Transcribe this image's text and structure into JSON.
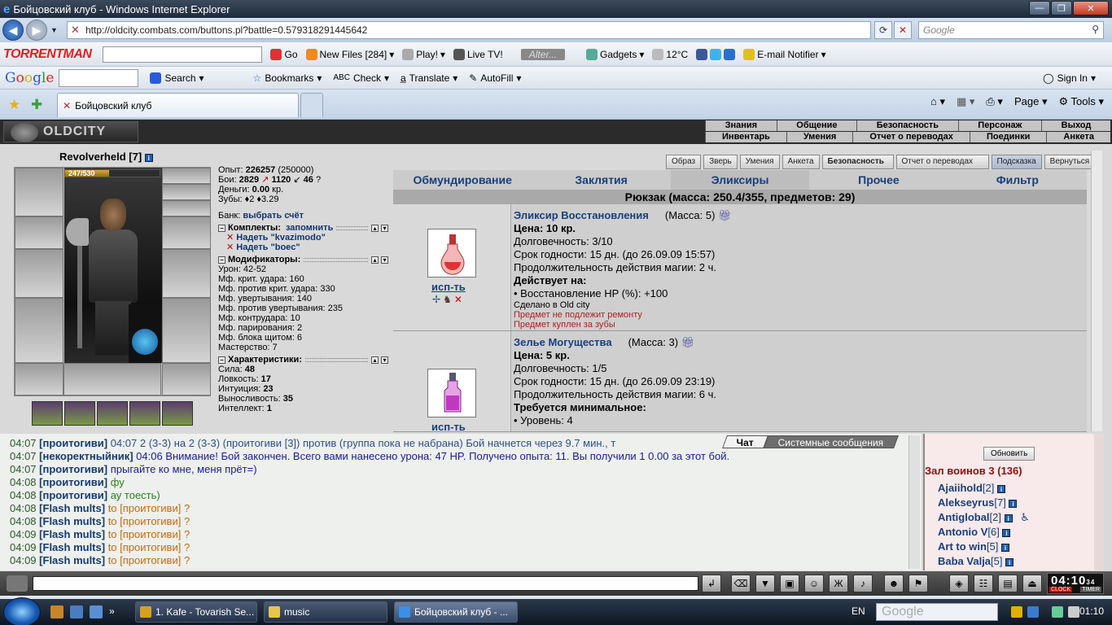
{
  "window": {
    "title": "Бойцовский клуб - Windows Internet Explorer",
    "url": "http://oldcity.combats.com/buttons.pl?battle=0.579318291445642",
    "search_placeholder": "Google"
  },
  "toolbars": {
    "torrent": {
      "logo": "TORRENTMAN",
      "go": "Go",
      "new_files": "New Files [284]",
      "play": "Play!",
      "live_tv": "Live TV!",
      "alter": "Alter...",
      "gadgets": "Gadgets",
      "temp": "12°C",
      "email": "E-mail Notifier"
    },
    "google": {
      "logo": [
        "G",
        "o",
        "o",
        "g",
        "l",
        "e"
      ],
      "search": "Search",
      "bookmarks": "Bookmarks",
      "check": "Check",
      "translate": "Translate",
      "autofill": "AutoFill",
      "signin": "Sign In"
    },
    "tab_title": "Бойцовский клуб",
    "cmd": {
      "page": "Page",
      "tools": "Tools"
    }
  },
  "game": {
    "logo": "OLDCITY",
    "menu_top": [
      "Знания",
      "Общение",
      "Безопасность",
      "Персонаж",
      "Выход"
    ],
    "menu_bottom": [
      "Инвентарь",
      "Умения",
      "Отчет о переводах",
      "Поединки",
      "Анкета"
    ],
    "character": {
      "name": "Revolverheld",
      "level": "[7]",
      "hp_text": "247/530",
      "hp_fraction": 0.466
    },
    "stats": {
      "exp_label": "Опыт:",
      "exp_value": "226257",
      "exp_next": "(250000)",
      "fights_label": "Бои:",
      "wins": "2829",
      "losses": "1120",
      "draws": "46",
      "money_label": "Деньги:",
      "money_value": "0.00",
      "money_unit": "кр.",
      "teeth_label": "Зубы:",
      "teeth_value": "2",
      "teeth_value2": "3.29",
      "bank_label": "Банк:",
      "bank_link": "выбрать счёт",
      "sets_title": "Комплекты:",
      "sets_remember": "запомнить",
      "sets": [
        "Надеть \"kvazimodo\"",
        "Надеть \"boec\""
      ],
      "mods_title": "Модификаторы:",
      "mods": [
        "Урон: 42-52",
        "Мф. крит. удара: 160",
        "Мф. против крит. удара: 330",
        "Мф. увертывания: 140",
        "Мф. против увертывания: 235",
        "Мф. контрудара: 10",
        "Мф. парирования: 2",
        "Мф. блока щитом: 6",
        "Мастерство: 7"
      ],
      "attrs_title": "Характеристики:",
      "attrs": [
        {
          "label": "Сила:",
          "value": "48"
        },
        {
          "label": "Ловкость:",
          "value": "17"
        },
        {
          "label": "Интуиция:",
          "value": "23"
        },
        {
          "label": "Выносливость:",
          "value": "35"
        },
        {
          "label": "Интеллект:",
          "value": "1"
        }
      ]
    },
    "top_buttons": [
      "Образ",
      "Зверь",
      "Умения",
      "Анкета",
      "Безопасность",
      "Отчет о переводах",
      "Подсказка",
      "Вернуться"
    ],
    "inv_tabs": [
      "Обмундирование",
      "Заклятия",
      "Эликсиры",
      "Прочее",
      "Фильтр"
    ],
    "backpack": "Рюкзак (масса: 250.4/355, предметов: 29)",
    "items": [
      {
        "use": "исп-ть",
        "name": "Эликсир Восстановления",
        "mass": "(Масса: 5)",
        "price": "Цена: 10 кр.",
        "durability": "Долговечность: 3/10",
        "expiry": "Срок годности: 15 дн. (до 26.09.09 15:57)",
        "duration": "Продолжительность действия магии: 2 ч.",
        "effect_title": "Действует на:",
        "effect": "• Восстановление HP (%): +100",
        "made": "Сделано в Old city",
        "note1": "Предмет не подлежит ремонту",
        "note2": "Предмет куплен за зубы"
      },
      {
        "use": "исп-ть",
        "name": "Зелье Могущества",
        "mass": "(Масса: 3)",
        "price": "Цена: 5 кр.",
        "durability": "Долговечность: 1/5",
        "expiry": "Срок годности: 15 дн. (до 26.09.09 23:19)",
        "duration": "Продолжительность действия магии: 6 ч.",
        "effect_title": "Требуется минимальное:",
        "effect": "• Уровень: 4"
      }
    ],
    "chat_tabs": [
      "Чат",
      "Системные сообщения"
    ],
    "chat": [
      {
        "time": "04:07",
        "nick": "[проитогиви]",
        "msg": " 04:07 2 (3-3) на 2 (3-3) (проитогиви [3]) против (группа пока не набрана) Бой начнется через 9.7 мин., т",
        "cls": "m1"
      },
      {
        "time": "04:07",
        "nick": "[некоректныйник]",
        "msg": " 04:06 Внимание! Бой закончен. Всего вами нанесено урона: 47 HP. Получено опыта: 11. Вы получили 1 0.00 за этот бой.",
        "cls": "m2"
      },
      {
        "time": "04:07",
        "nick": "[проитогиви]",
        "msg": " прыгайте ко мне, меня прёт=)",
        "cls": "m2"
      },
      {
        "time": "04:08",
        "nick": "[проитогиви]",
        "msg": " фу",
        "cls": "m3"
      },
      {
        "time": "04:08",
        "nick": "[проитогиви]",
        "msg": " ау тоесть)",
        "cls": "m3"
      },
      {
        "time": "04:08",
        "nick": "[Flash mults]",
        "msg": " to [проитогиви] ?",
        "cls": "m4"
      },
      {
        "time": "04:08",
        "nick": "[Flash mults]",
        "msg": " to [проитогиви] ?",
        "cls": "m4"
      },
      {
        "time": "04:09",
        "nick": "[Flash mults]",
        "msg": " to [проитогиви] ?",
        "cls": "m4"
      },
      {
        "time": "04:09",
        "nick": "[Flash mults]",
        "msg": " to [проитогиви] ?",
        "cls": "m4"
      },
      {
        "time": "04:09",
        "nick": "[Flash mults]",
        "msg": " to [проитогиви] ?",
        "cls": "m4"
      }
    ],
    "online": {
      "refresh": "Обновить",
      "room": "Зал воинов 3 (136)",
      "users": [
        {
          "name": "Ajaiihold",
          "lvl": "[2]"
        },
        {
          "name": "Alekseyrus",
          "lvl": "[7]"
        },
        {
          "name": "Antiglobal",
          "lvl": "[2]"
        },
        {
          "name": "Antonio V",
          "lvl": "[6]"
        },
        {
          "name": "Art to win",
          "lvl": "[5]"
        },
        {
          "name": "Baba Valja",
          "lvl": "[5]"
        }
      ]
    },
    "clock": {
      "time": "04:10",
      "sec": "34",
      "lbl1": "CLOCK",
      "lbl2": "TIMER"
    }
  },
  "taskbar": {
    "tasks": [
      "1. Kafe - Tovarish Se...",
      "music",
      "Бойцовский клуб - ..."
    ],
    "lang": "EN",
    "gsearch": "Google",
    "time": "01:10"
  }
}
